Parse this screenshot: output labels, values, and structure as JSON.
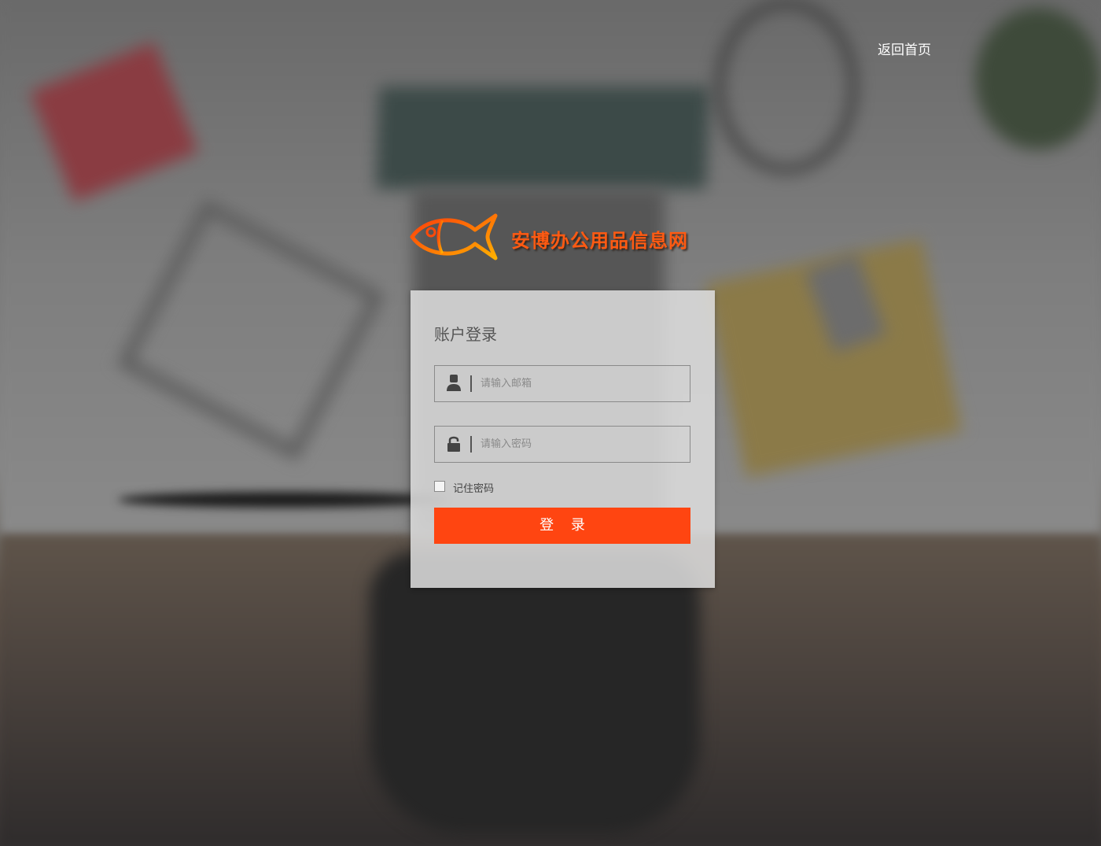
{
  "header": {
    "home_link": "返回首页"
  },
  "brand": {
    "name": "安博办公用品信息网",
    "logo_icon": "fish-icon",
    "color": "#ff5a12"
  },
  "login": {
    "title": "账户登录",
    "email": {
      "icon": "user-icon",
      "placeholder": "请输入邮箱",
      "value": ""
    },
    "password": {
      "icon": "lock-icon",
      "placeholder": "请输入密码",
      "value": ""
    },
    "remember_label": "记住密码",
    "remember_checked": false,
    "submit_label": "登 录",
    "accent_color": "#ff4511"
  }
}
